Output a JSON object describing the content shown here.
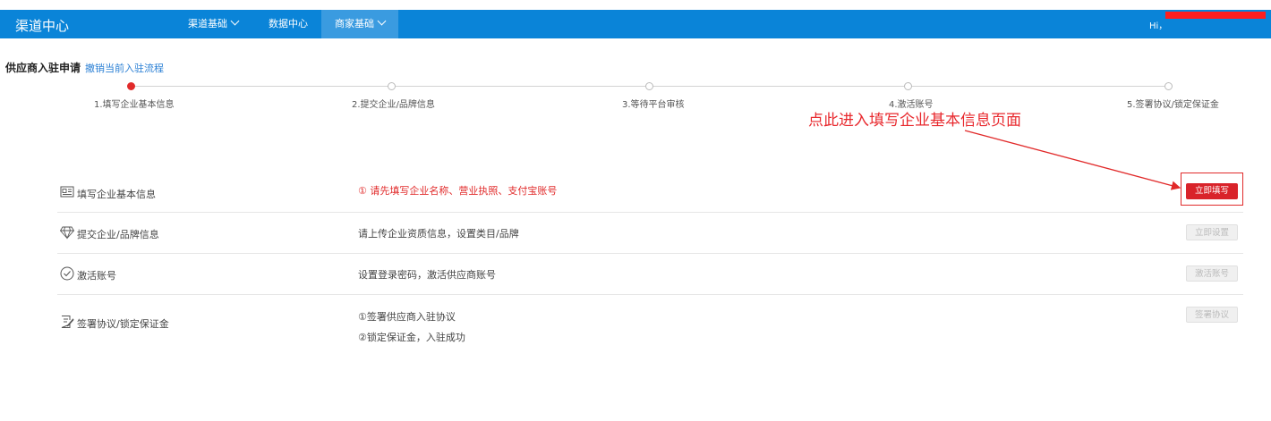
{
  "header": {
    "brand": "渠道中心",
    "nav": [
      {
        "label": "渠道基础",
        "has_dropdown": true,
        "active": false
      },
      {
        "label": "数据中心",
        "has_dropdown": false,
        "active": false
      },
      {
        "label": "商家基础",
        "has_dropdown": true,
        "active": true
      }
    ],
    "greeting": "Hi，"
  },
  "page": {
    "title": "供应商入驻申请",
    "cancel_link": "撤销当前入驻流程"
  },
  "steps": [
    {
      "label": "1.填写企业基本信息",
      "active": true
    },
    {
      "label": "2.提交企业/品牌信息",
      "active": false
    },
    {
      "label": "3.等待平台审核",
      "active": false
    },
    {
      "label": "4.激活账号",
      "active": false
    },
    {
      "label": "5.签署协议/锁定保证金",
      "active": false
    }
  ],
  "annotation": "点此进入填写企业基本信息页面",
  "tasks": [
    {
      "name": "填写企业基本信息",
      "icon": "id-card-icon",
      "desc": [
        "① 请先填写企业名称、营业执照、支付宝账号"
      ],
      "warn": true,
      "button": "立即填写",
      "enabled": true
    },
    {
      "name": "提交企业/品牌信息",
      "icon": "diamond-icon",
      "desc": [
        "请上传企业资质信息，设置类目/品牌"
      ],
      "warn": false,
      "button": "立即设置",
      "enabled": false
    },
    {
      "name": "激活账号",
      "icon": "check-circle-icon",
      "desc": [
        "设置登录密码，激活供应商账号"
      ],
      "warn": false,
      "button": "激活账号",
      "enabled": false
    },
    {
      "name": "签署协议/锁定保证金",
      "icon": "sign-document-icon",
      "desc": [
        "①签署供应商入驻协议",
        "②锁定保证金，入驻成功"
      ],
      "warn": false,
      "button": "签署协议",
      "enabled": false
    }
  ],
  "colors": {
    "header": "#0a84d8",
    "accent": "#d9232a",
    "link": "#2a7fd4"
  }
}
